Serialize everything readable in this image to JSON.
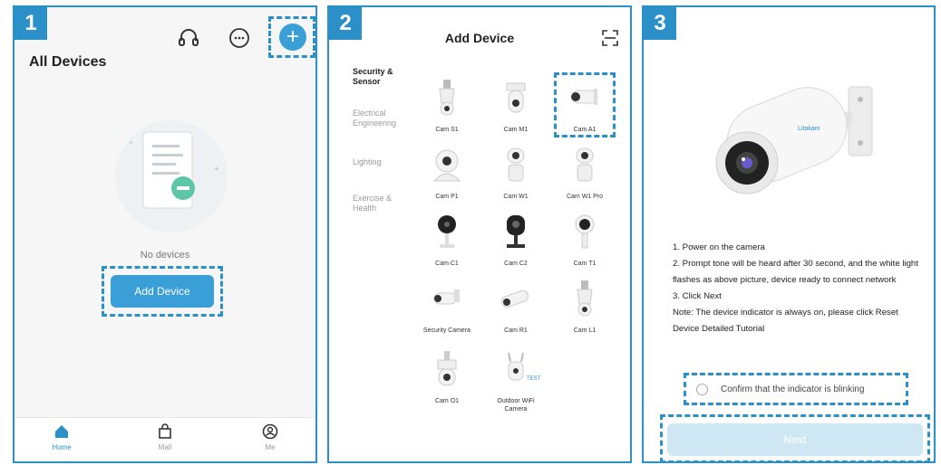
{
  "steps": [
    "1",
    "2",
    "3"
  ],
  "screen1": {
    "title": "All Devices",
    "header_icons": [
      "headset-icon",
      "chat-bubble-icon",
      "plus-icon"
    ],
    "plus_symbol": "+",
    "empty_text": "No devices",
    "add_button": "Add Device",
    "tabs": [
      {
        "label": "Home",
        "icon": "home-icon",
        "active": true
      },
      {
        "label": "Mall",
        "icon": "shopping-bag-icon",
        "active": false
      },
      {
        "label": "Me",
        "icon": "user-icon",
        "active": false
      }
    ]
  },
  "screen2": {
    "title": "Add Device",
    "categories": [
      {
        "label": "Security & Sensor",
        "active": true
      },
      {
        "label": "Electrical Engineering",
        "active": false
      },
      {
        "label": "Lighting",
        "active": false
      },
      {
        "label": "Exercise & Health",
        "active": false
      }
    ],
    "devices": [
      "Cam S1",
      "Cam M1",
      "Cam A1",
      "Cam P1",
      "Cam W1",
      "Cam W1 Pro",
      "Cam C1",
      "Cam C2",
      "Cam T1",
      "Security Camera",
      "Cam R1",
      "Cam L1",
      "Cam O1",
      "Outdoor WiFi Camera"
    ],
    "test_tag": "TEST",
    "selected_device": "Cam A1"
  },
  "screen3": {
    "camera_brand": "Litokam",
    "instructions": [
      "1. Power on the camera",
      "2. Prompt tone will be heard after 30 second, and the white light flashes as above picture, device ready to connect network",
      "3. Click Next",
      "Note: The device indicator is always on, please click Reset Device Detailed Tutorial"
    ],
    "confirm_label": "Confirm that the indicator is blinking",
    "next_button": "Next"
  },
  "colors": {
    "accent": "#2c90c8",
    "button": "#3a9fd6",
    "next_disabled": "#cfe6f3"
  }
}
